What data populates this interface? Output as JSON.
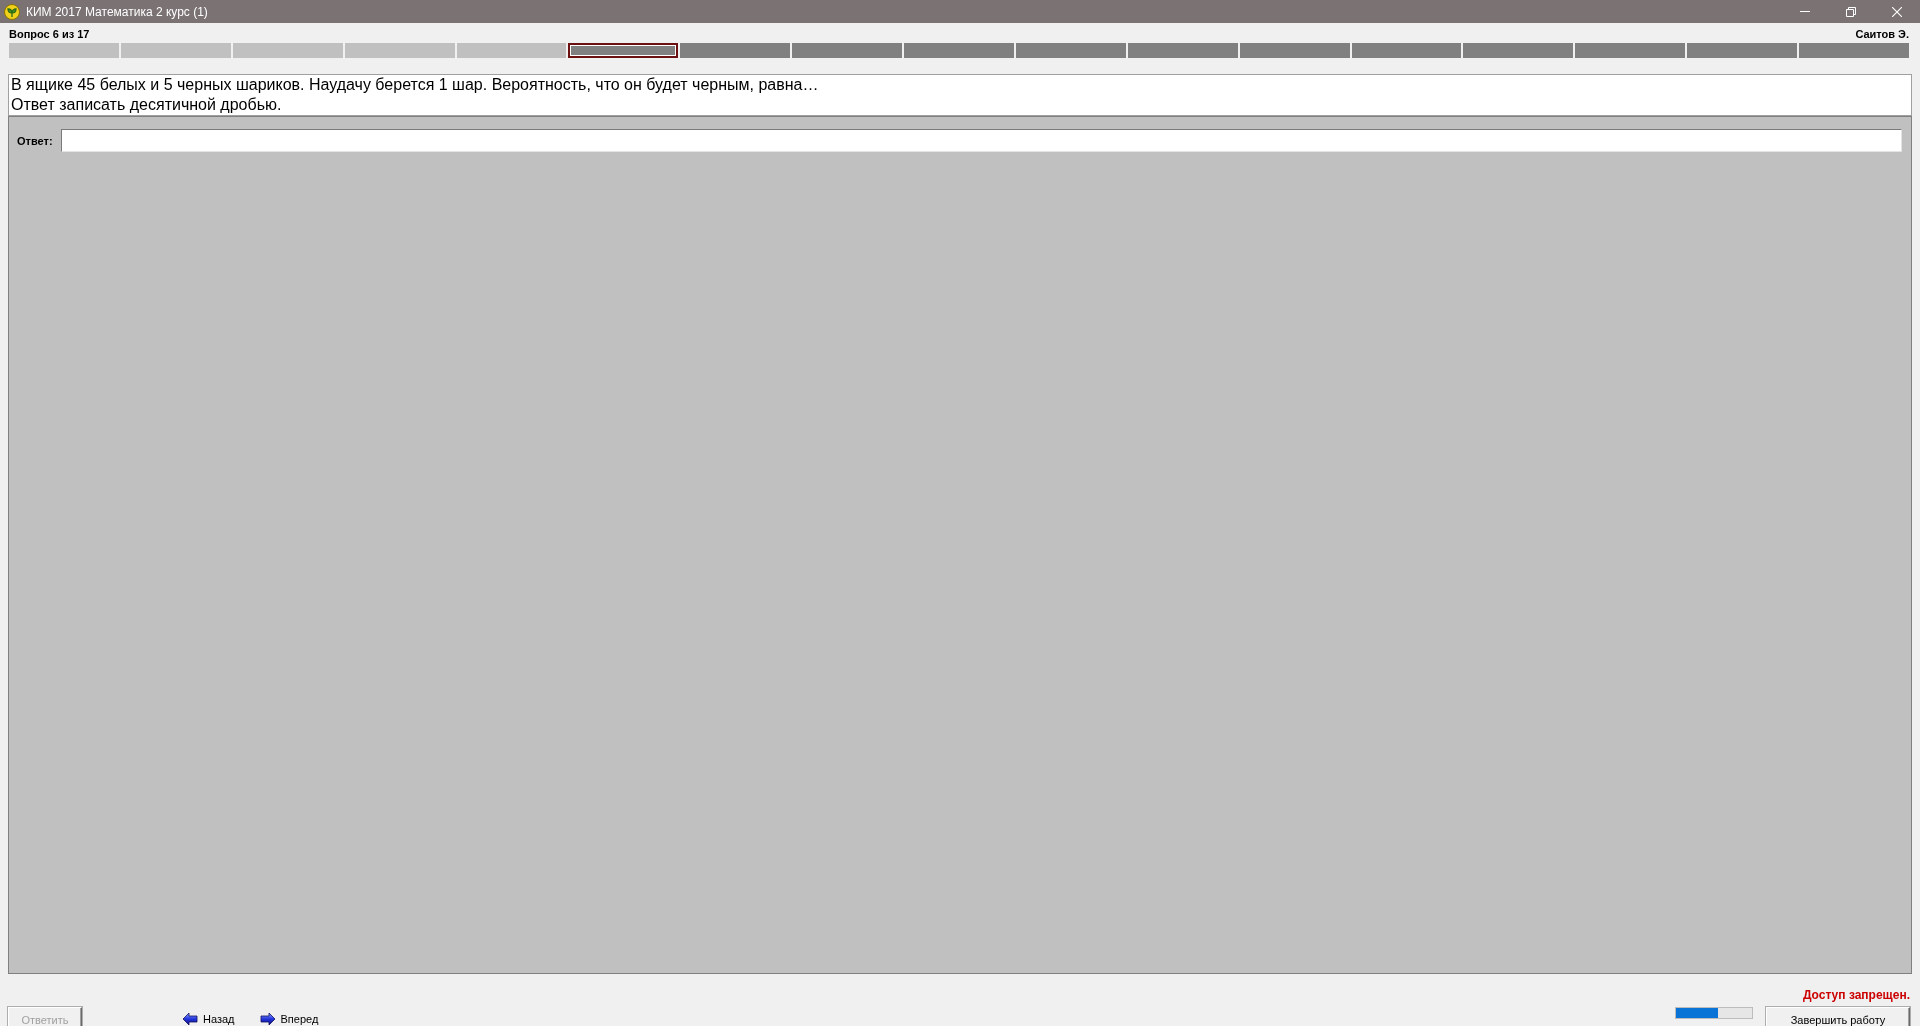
{
  "window": {
    "title": "КИМ 2017 Математика 2 курс (1)"
  },
  "header": {
    "question_counter": "Вопрос 6 из 17",
    "student": "Саитов Э."
  },
  "question_map": [
    {
      "answered": true,
      "selected": false
    },
    {
      "answered": true,
      "selected": false
    },
    {
      "answered": true,
      "selected": false
    },
    {
      "answered": true,
      "selected": false
    },
    {
      "answered": true,
      "selected": false
    },
    {
      "answered": false,
      "selected": true
    },
    {
      "answered": false,
      "selected": false
    },
    {
      "answered": false,
      "selected": false
    },
    {
      "answered": false,
      "selected": false
    },
    {
      "answered": false,
      "selected": false
    },
    {
      "answered": false,
      "selected": false
    },
    {
      "answered": false,
      "selected": false
    },
    {
      "answered": false,
      "selected": false
    },
    {
      "answered": false,
      "selected": false
    },
    {
      "answered": false,
      "selected": false
    },
    {
      "answered": false,
      "selected": false
    },
    {
      "answered": false,
      "selected": false
    }
  ],
  "question": {
    "text": "В ящике 45 белых и 5 черных шариков. Наудачу берется 1 шар. Вероятность, что он будет черным, равна…",
    "instruction": "Ответ записать десятичной дробью."
  },
  "answer": {
    "label": "Ответ:"
  },
  "status": {
    "message": "Доступ запрещен."
  },
  "footer": {
    "submit": {
      "label": "Ответить",
      "disabled": true
    },
    "navigation": [
      {
        "kind": "back",
        "label": "Назад"
      },
      {
        "kind": "forward",
        "label": "Вперед"
      }
    ],
    "timer": {
      "level": 0.55
    },
    "finish": {
      "label": "Завершить работу"
    }
  }
}
